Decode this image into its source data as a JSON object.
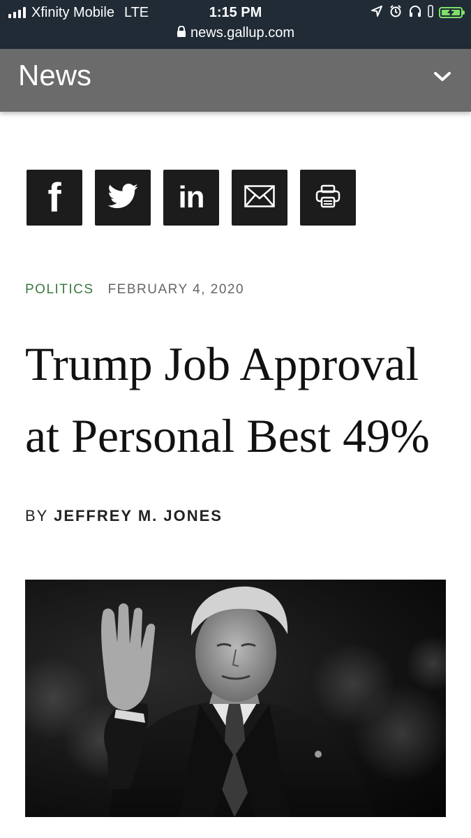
{
  "status_bar": {
    "carrier": "Xfinity Mobile",
    "network": "LTE",
    "time": "1:15 PM",
    "url": "news.gallup.com"
  },
  "header": {
    "title": "News"
  },
  "share": {
    "icons": [
      "facebook-icon",
      "twitter-icon",
      "linkedin-icon",
      "email-icon",
      "print-icon"
    ],
    "facebook_glyph": "f",
    "linkedin_glyph": "in"
  },
  "article": {
    "category": "POLITICS",
    "date": "FEBRUARY 4, 2020",
    "headline_line1": "Trump Job Approval",
    "headline_line2": "at Personal Best 49%",
    "byline_prefix": "BY",
    "author": "JEFFREY M. JONES"
  },
  "colors": {
    "status_bg": "#202b36",
    "header_bg": "#6b6b6b",
    "category_green": "#3c7a3e",
    "share_bg": "#1c1c1c",
    "battery_green": "#7ee06a"
  }
}
